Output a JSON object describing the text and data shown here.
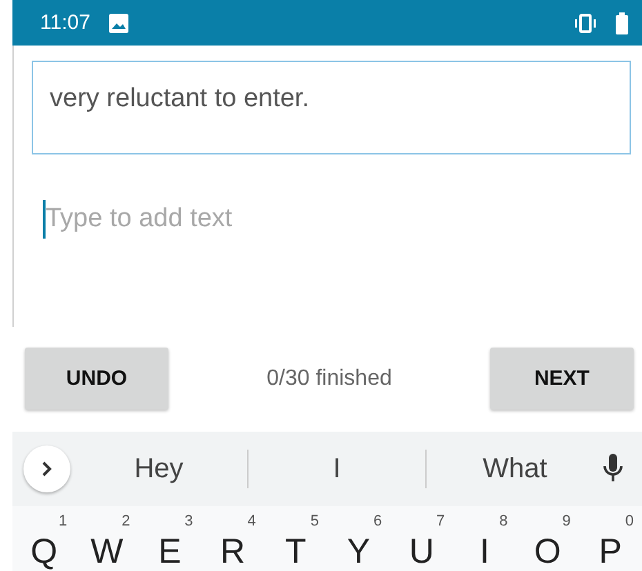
{
  "status_bar": {
    "time": "11:07"
  },
  "prompt": {
    "text": "very reluctant to enter."
  },
  "entry": {
    "placeholder": "Type to add text"
  },
  "controls": {
    "undo": "UNDO",
    "progress": "0/30 finished",
    "next": "NEXT"
  },
  "suggestions": [
    "Hey",
    "I",
    "What"
  ],
  "keys": [
    {
      "letter": "Q",
      "hint": "1"
    },
    {
      "letter": "W",
      "hint": "2"
    },
    {
      "letter": "E",
      "hint": "3"
    },
    {
      "letter": "R",
      "hint": "4"
    },
    {
      "letter": "T",
      "hint": "5"
    },
    {
      "letter": "Y",
      "hint": "6"
    },
    {
      "letter": "U",
      "hint": "7"
    },
    {
      "letter": "I",
      "hint": "8"
    },
    {
      "letter": "O",
      "hint": "9"
    },
    {
      "letter": "P",
      "hint": "0"
    }
  ]
}
